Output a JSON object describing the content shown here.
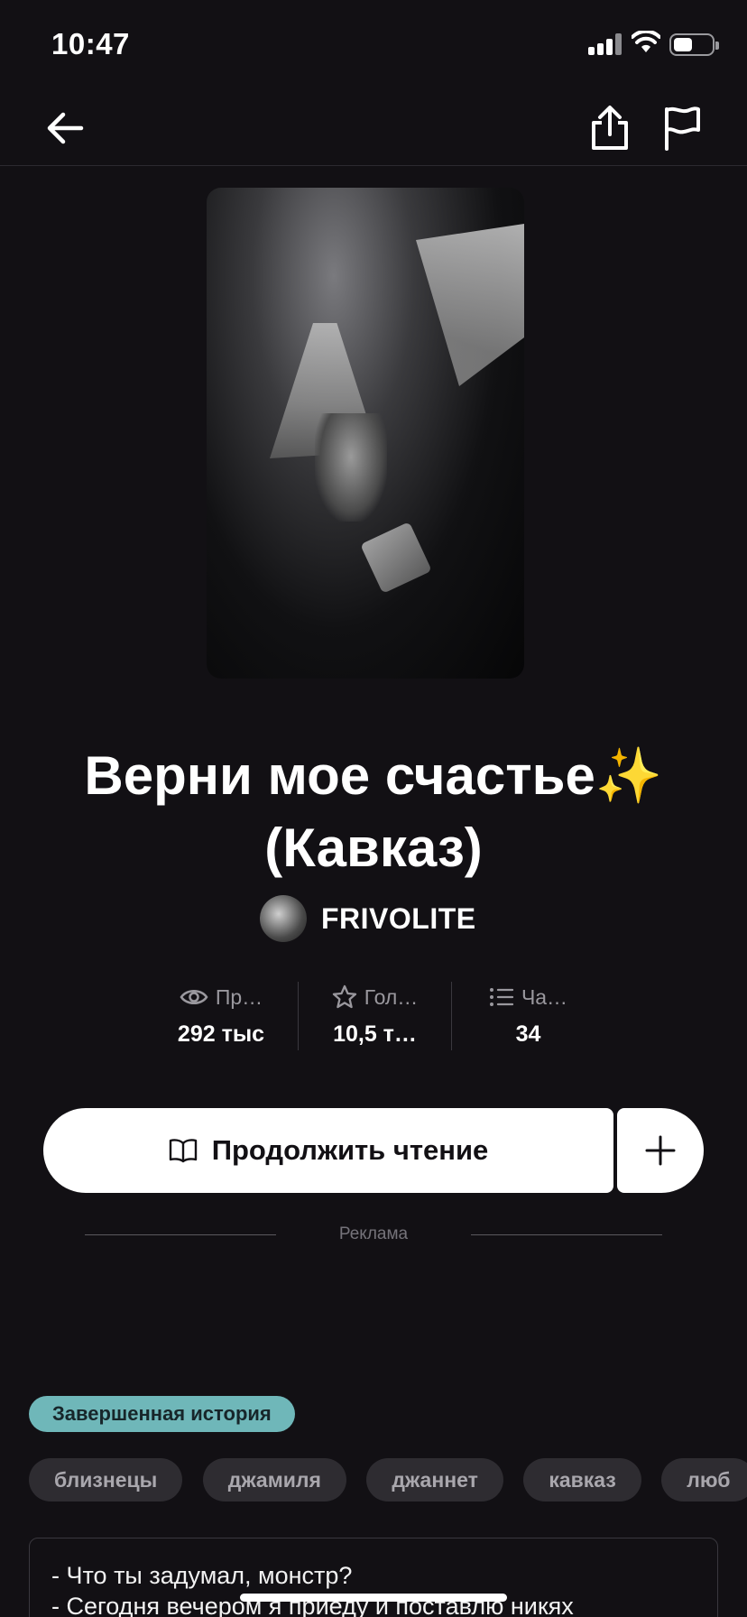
{
  "status_bar": {
    "time": "10:47"
  },
  "story": {
    "title": "Верни мое счастье✨ (Кавказ)",
    "author": "FRIVOLITE"
  },
  "stats": [
    {
      "icon": "eye-icon",
      "label": "Пр…",
      "value": "292 тыс"
    },
    {
      "icon": "star-icon",
      "label": "Гол…",
      "value": "10,5 т…"
    },
    {
      "icon": "list-icon",
      "label": "Ча…",
      "value": "34"
    }
  ],
  "actions": {
    "continue_label": "Продолжить чтение"
  },
  "ad": {
    "label": "Реклама"
  },
  "status_badge": "Завершенная история",
  "tags": [
    "близнецы",
    "джамиля",
    "джаннет",
    "кавказ",
    "люб"
  ],
  "description": [
    "- Что ты задумал, монстр?",
    "- Сегодня вечером я приеду и поставлю никях"
  ],
  "colors": {
    "background": "#121014",
    "badge": "#6fb7b9",
    "tag_bg": "#2e2c31"
  }
}
